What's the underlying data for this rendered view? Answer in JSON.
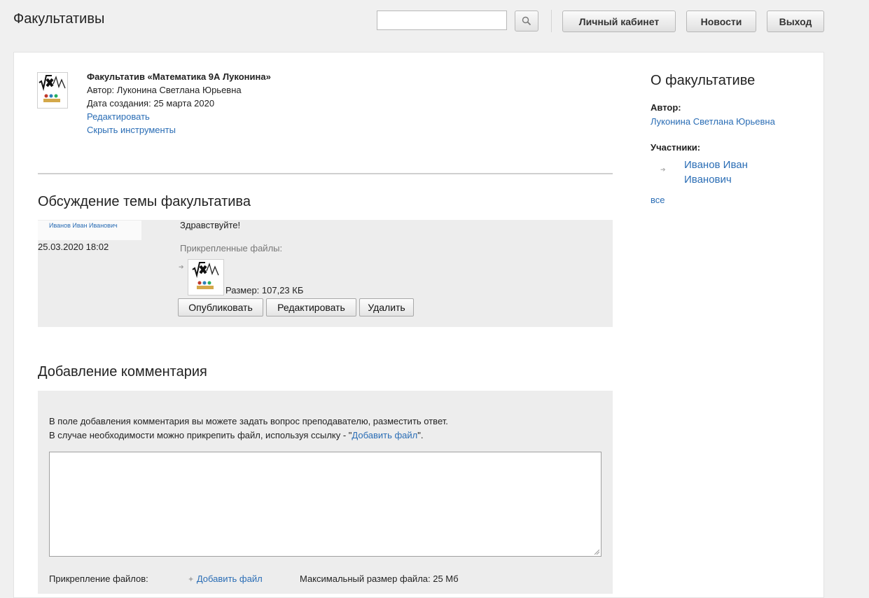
{
  "header": {
    "site_title": "Факультативы",
    "search": {
      "value": "",
      "placeholder": ""
    },
    "nav": {
      "cabinet": "Личный кабинет",
      "news": "Новости",
      "logout": "Выход"
    }
  },
  "course": {
    "title": "Факультатив «Математика 9А Луконина»",
    "author": "Автор: Луконина Светлана Юрьевна",
    "created": "Дата создания: 25 марта 2020",
    "edit_link": "Редактировать",
    "hide_tools_link": "Скрыть инструменты"
  },
  "discussion": {
    "heading": "Обсуждение темы факультатива",
    "post": {
      "author": "Иванов Иван Иванович",
      "date": "25.03.2020 18:02",
      "text": "Здравствуйте!",
      "files_label": "Прикрепленные файлы:",
      "file_size": "Размер: 107,23 КБ",
      "actions": {
        "publish": "Опубликовать",
        "edit": "Редактировать",
        "delete": "Удалить"
      }
    }
  },
  "add_comment": {
    "heading": "Добавление комментария",
    "hint_line1": "В поле добавления комментария вы можете задать вопрос преподавателю, разместить ответ.",
    "hint_line2_prefix": "В случае необходимости можно прикрепить файл, используя ссылку - \"",
    "hint_line2_link": "Добавить файл",
    "hint_line2_suffix": "\".",
    "textarea_value": "",
    "attach_label": "Прикрепление файлов:",
    "attach_link": "Добавить файл",
    "max_size": "Максимальный размер файла: 25 Мб"
  },
  "sidebar": {
    "title": "О факультативе",
    "author_label": "Автор:",
    "author_name": "Луконина Светлана Юрьевна",
    "members_label": "Участники:",
    "members": [
      "Иванов Иван Иванович"
    ],
    "all_link": "все"
  },
  "colors": {
    "link": "#2a6db5",
    "page_bg": "#f0f0f0",
    "block_bg": "#ededed"
  },
  "icons": [
    "search-icon",
    "math-course-icon",
    "file-thumbnail-icon",
    "bullet-icon",
    "resize-grip-icon"
  ]
}
